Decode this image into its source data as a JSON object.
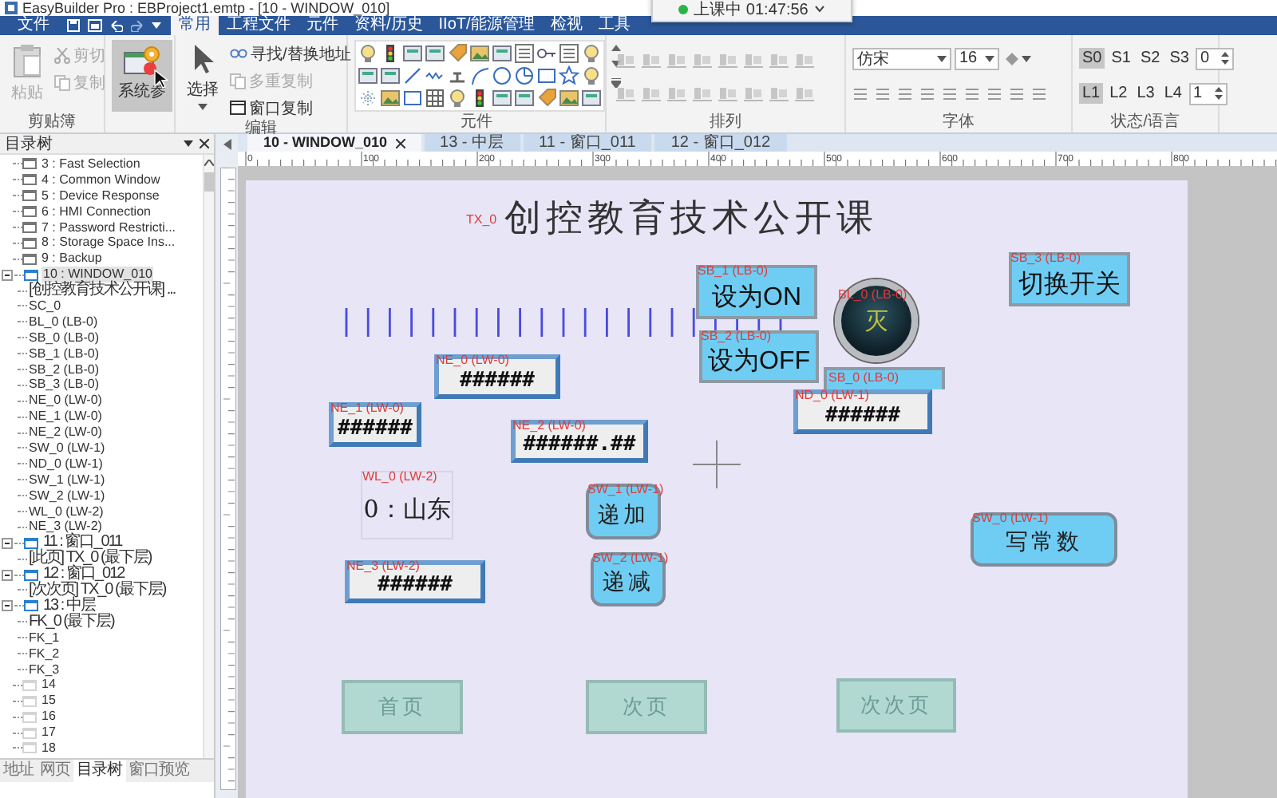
{
  "window": {
    "title": "EasyBuilder Pro : EBProject1.emtp - [10 - WINDOW_010]"
  },
  "class_timer": {
    "status": "上课中 01:47:56"
  },
  "menu_tabs": [
    {
      "label": "文件",
      "selected": false
    },
    {
      "label": "常用",
      "selected": true
    },
    {
      "label": "工程文件",
      "selected": false
    },
    {
      "label": "元件",
      "selected": false
    },
    {
      "label": "资料/历史",
      "selected": false
    },
    {
      "label": "IIoT/能源管理",
      "selected": false
    },
    {
      "label": "检视",
      "selected": false
    },
    {
      "label": "工具",
      "selected": false
    }
  ],
  "ribbon": {
    "clipboard": {
      "title": "剪贴簿",
      "paste": {
        "label": "粘贴",
        "disabled": true
      },
      "cut": {
        "label": "剪切",
        "disabled": true
      },
      "copy": {
        "label": "复制",
        "disabled": true
      }
    },
    "system": {
      "label": "系统参",
      "selected": true
    },
    "edit": {
      "title": "编辑",
      "select": "选择",
      "find_replace": {
        "label": "寻找/替换地址",
        "disabled": false
      },
      "multi_copy": {
        "label": "多重复制",
        "disabled": true
      },
      "window_copy": {
        "label": "窗口复制",
        "disabled": false
      }
    },
    "objects": {
      "title": "元件"
    },
    "arrange": {
      "title": "排列"
    },
    "font": {
      "title": "字体",
      "family": "仿宋",
      "size": "16"
    },
    "state": {
      "title": "状态/语言",
      "states": [
        {
          "label": "S0",
          "selected": true
        },
        {
          "label": "S1",
          "selected": false
        },
        {
          "label": "S2",
          "selected": false
        },
        {
          "label": "S3",
          "selected": false
        }
      ],
      "state_value": "0",
      "languages": [
        {
          "label": "L1",
          "selected": true
        },
        {
          "label": "L2",
          "selected": false
        },
        {
          "label": "L3",
          "selected": false
        },
        {
          "label": "L4",
          "selected": false
        }
      ],
      "language_value": "1"
    }
  },
  "tree_panel": {
    "title": "目录树",
    "items": [
      {
        "label": "3 : Fast Selection",
        "selected": false,
        "empty": false
      },
      {
        "label": "4 : Common Window",
        "selected": false,
        "empty": false
      },
      {
        "label": "5 : Device Response",
        "selected": false,
        "empty": false
      },
      {
        "label": "6 : HMI Connection",
        "selected": false,
        "empty": false
      },
      {
        "label": "7 : Password Restricti...",
        "selected": false,
        "empty": false
      },
      {
        "label": "8 : Storage Space Ins...",
        "selected": false,
        "empty": false
      },
      {
        "label": "9 : Backup",
        "selected": false,
        "empty": false
      },
      {
        "label": "10 : WINDOW_010",
        "selected": true,
        "empty": false,
        "expanded": true,
        "children": [
          {
            "label": "[创控教育技术公开课] ...",
            "selected": false
          },
          {
            "label": "SC_0",
            "selected": false
          },
          {
            "label": "BL_0 (LB-0)",
            "selected": false
          },
          {
            "label": "SB_0 (LB-0)",
            "selected": false
          },
          {
            "label": "SB_1 (LB-0)",
            "selected": false
          },
          {
            "label": "SB_2 (LB-0)",
            "selected": false
          },
          {
            "label": "SB_3 (LB-0)",
            "selected": false
          },
          {
            "label": "NE_0 (LW-0)",
            "selected": false
          },
          {
            "label": "NE_1 (LW-0)",
            "selected": false
          },
          {
            "label": "NE_2 (LW-0)",
            "selected": false
          },
          {
            "label": "SW_0 (LW-1)",
            "selected": false
          },
          {
            "label": "ND_0 (LW-1)",
            "selected": false
          },
          {
            "label": "SW_1 (LW-1)",
            "selected": false
          },
          {
            "label": "SW_2 (LW-1)",
            "selected": false
          },
          {
            "label": "WL_0 (LW-2)",
            "selected": false
          },
          {
            "label": "NE_3 (LW-2)",
            "selected": false
          }
        ]
      },
      {
        "label": "11 : 窗口_011",
        "selected": false,
        "empty": false,
        "expanded": true,
        "children": [
          {
            "label": "[此页] TX_0 (最下层)",
            "selected": false
          }
        ]
      },
      {
        "label": "12 : 窗口_012",
        "selected": false,
        "empty": false,
        "expanded": true,
        "children": [
          {
            "label": "[次次页] TX_0 (最下层)",
            "selected": false
          }
        ]
      },
      {
        "label": "13 : 中层",
        "selected": false,
        "empty": false,
        "expanded": true,
        "children": [
          {
            "label": "FK_0 (最下层)",
            "selected": false
          },
          {
            "label": "FK_1",
            "selected": false
          },
          {
            "label": "FK_2",
            "selected": false
          },
          {
            "label": "FK_3",
            "selected": false
          }
        ]
      },
      {
        "label": "14",
        "selected": false,
        "empty": true
      },
      {
        "label": "15",
        "selected": false,
        "empty": true
      },
      {
        "label": "16",
        "selected": false,
        "empty": true
      },
      {
        "label": "17",
        "selected": false,
        "empty": true
      },
      {
        "label": "18",
        "selected": false,
        "empty": true
      }
    ],
    "tabs": [
      {
        "label": "地址",
        "selected": false
      },
      {
        "label": "网页",
        "selected": false
      },
      {
        "label": "目录树",
        "selected": true
      },
      {
        "label": "窗口预览",
        "selected": false
      }
    ]
  },
  "doc_tabs": [
    {
      "label": "10 - WINDOW_010",
      "selected": true
    },
    {
      "label": "13 - 中层",
      "selected": false
    },
    {
      "label": "11 - 窗口_011",
      "selected": false
    },
    {
      "label": "12 - 窗口_012",
      "selected": false
    }
  ],
  "ruler": {
    "labels": [
      "0",
      "100",
      "200",
      "300",
      "400",
      "500",
      "600",
      "700",
      "800"
    ]
  },
  "canvas": {
    "objects": [
      {
        "kind": "label",
        "tag": "TX_0",
        "text": "创控教育技术公开课"
      },
      {
        "kind": "scale"
      },
      {
        "kind": "set_bit",
        "tag": "SB_1 (LB-0)",
        "text": "设为ON"
      },
      {
        "kind": "set_bit",
        "tag": "SB_2 (LB-0)",
        "text": "设为OFF"
      },
      {
        "kind": "lamp",
        "tag": "BL_0 (LB-0)",
        "text": "灭"
      },
      {
        "kind": "set_bit",
        "tag": "SB_3 (LB-0)",
        "text": "切换开关"
      },
      {
        "kind": "numeric",
        "tag": "NE_0 (LW-0)",
        "text": "######"
      },
      {
        "kind": "numeric",
        "tag": "NE_1 (LW-0)",
        "text": "######"
      },
      {
        "kind": "numeric",
        "tag": "NE_2 (LW-0)",
        "text": "######.##"
      },
      {
        "kind": "set_bit",
        "tag": "SB_0 (LB-0)"
      },
      {
        "kind": "numeric",
        "tag": "ND_0 (LW-1)",
        "text": "######"
      },
      {
        "kind": "word_lamp",
        "tag": "WL_0 (LW-2)",
        "text": "0：山东"
      },
      {
        "kind": "set_word",
        "tag": "SW_1 (LW-1)",
        "text": "递加"
      },
      {
        "kind": "set_word",
        "tag": "SW_2 (LW-1)",
        "text": "递减"
      },
      {
        "kind": "set_word",
        "tag": "SW_0 (LW-1)",
        "text": "写常数"
      },
      {
        "kind": "numeric",
        "tag": "NE_3 (LW-2)",
        "text": "######"
      },
      {
        "kind": "page_button",
        "text": "首页"
      },
      {
        "kind": "page_button",
        "text": "次页"
      },
      {
        "kind": "page_button",
        "text": "次次页"
      }
    ]
  }
}
